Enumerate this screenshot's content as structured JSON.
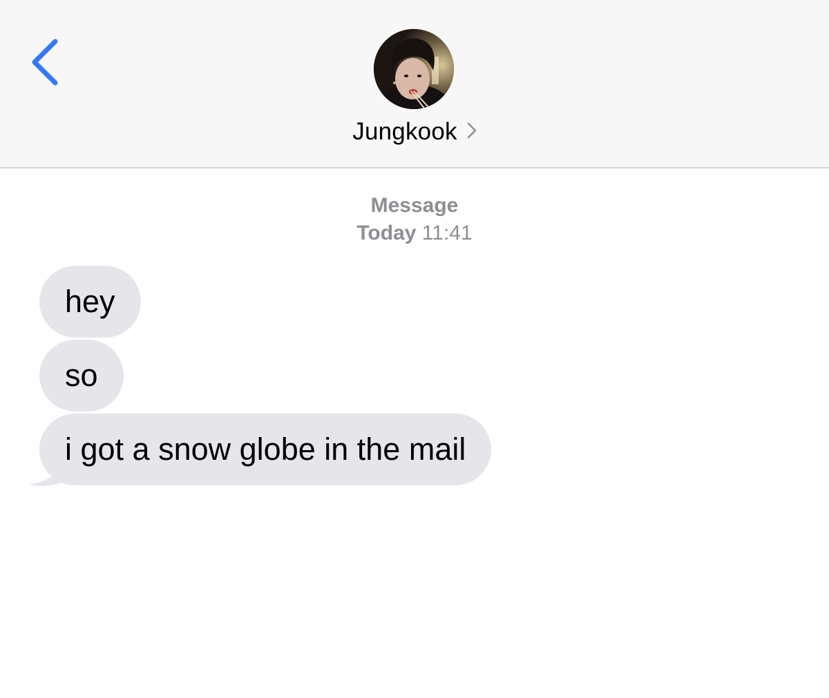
{
  "header": {
    "contact_name": "Jungkook",
    "back_icon": "chevron-left-icon",
    "detail_icon": "chevron-right-icon",
    "accent_color": "#3478f6"
  },
  "thread": {
    "service_label": "Message",
    "date_label": "Today",
    "time_label": "11:41"
  },
  "messages": [
    {
      "text": "hey",
      "direction": "incoming"
    },
    {
      "text": "so",
      "direction": "incoming"
    },
    {
      "text": "i got a snow globe in the mail",
      "direction": "incoming"
    }
  ],
  "colors": {
    "incoming_bubble": "#e5e5ea",
    "meta_text": "#8e8e93",
    "header_bg": "#f7f7f7"
  }
}
